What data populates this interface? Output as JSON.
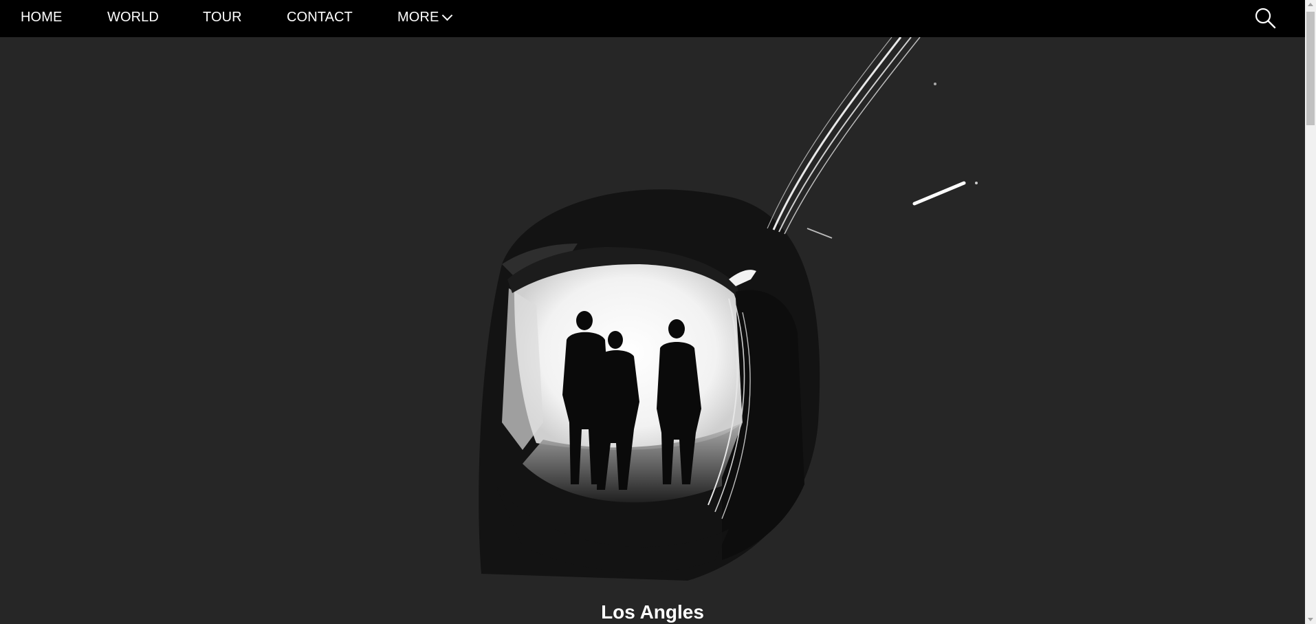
{
  "nav": {
    "items": [
      {
        "label": "HOME"
      },
      {
        "label": "WORLD"
      },
      {
        "label": "TOUR"
      },
      {
        "label": "CONTACT"
      },
      {
        "label": "MORE"
      }
    ]
  },
  "icons": {
    "search": "search-icon",
    "more_dropdown": "chevron-down-icon"
  },
  "hero": {
    "caption": "Los Angles"
  },
  "colors": {
    "nav_background": "#000000",
    "page_background": "#262626",
    "text": "#ffffff"
  }
}
